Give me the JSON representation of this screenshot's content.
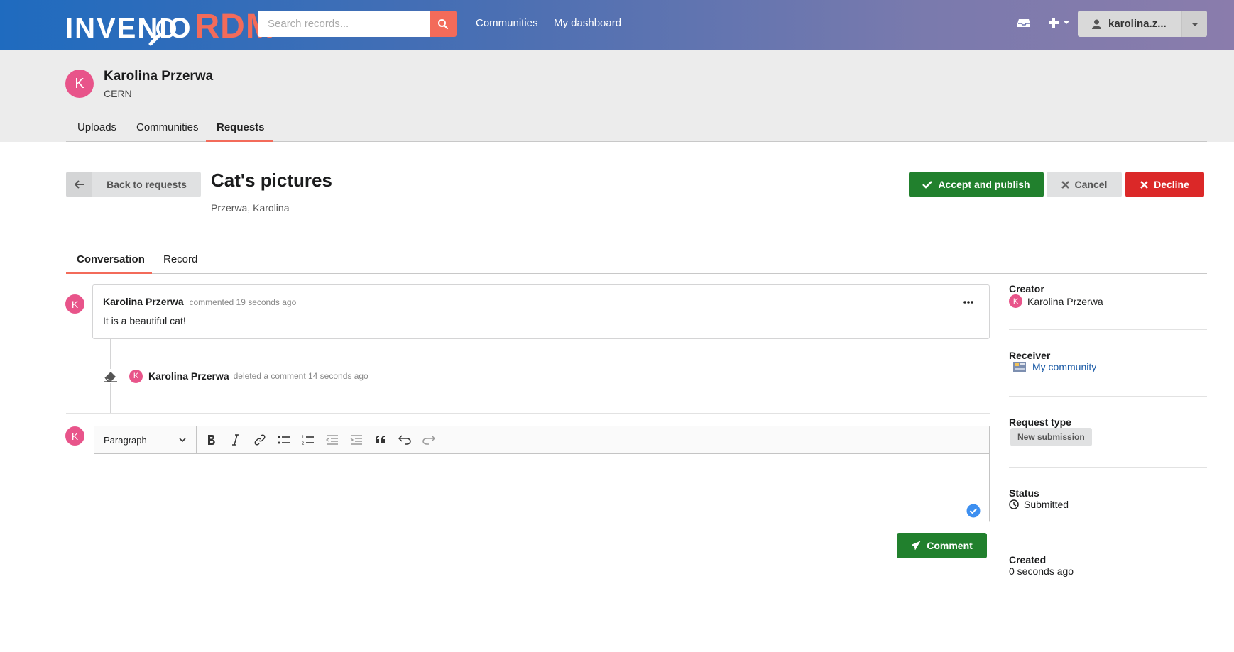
{
  "header": {
    "logo_text": "INVENIO",
    "logo_suffix": "RDM",
    "search_placeholder": "Search records...",
    "nav": [
      "Communities",
      "My dashboard"
    ],
    "user_label": "karolina.z..."
  },
  "profile": {
    "initial": "K",
    "name": "Karolina Przerwa",
    "affiliation": "CERN",
    "tabs": [
      "Uploads",
      "Communities",
      "Requests"
    ],
    "active_tab": "Requests"
  },
  "request": {
    "back_label": "Back to requests",
    "title": "Cat's pictures",
    "creators": "Przerwa, Karolina",
    "actions": {
      "accept": "Accept and publish",
      "cancel": "Cancel",
      "decline": "Decline"
    },
    "tabs": [
      "Conversation",
      "Record"
    ],
    "active_tab": "Conversation"
  },
  "conversation": {
    "comment": {
      "initial": "K",
      "author": "Karolina Przerwa",
      "meta": "commented 19 seconds ago",
      "body": "It is a beautiful cat!"
    },
    "event": {
      "initial": "K",
      "author": "Karolina Przerwa",
      "meta": "deleted a comment 14 seconds ago"
    }
  },
  "editor": {
    "initial": "K",
    "paragraph_select": "Paragraph",
    "toolbar_icons": [
      "bold-icon",
      "italic-icon",
      "link-icon",
      "bullet-list-icon",
      "numbered-list-icon",
      "outdent-icon",
      "indent-icon",
      "blockquote-icon",
      "undo-icon",
      "redo-icon"
    ],
    "comment_button": "Comment"
  },
  "sidebar": {
    "creator_label": "Creator",
    "creator_initial": "K",
    "creator_name": "Karolina Przerwa",
    "receiver_label": "Receiver",
    "receiver_name": "My community",
    "request_type_label": "Request type",
    "request_type": "New submission",
    "status_label": "Status",
    "status": "Submitted",
    "created_label": "Created",
    "created": "0 seconds ago"
  },
  "colors": {
    "accent": "#f36b5a",
    "primary_green": "#21802d",
    "decline_red": "#db2828",
    "avatar_pink": "#e8548a",
    "link_blue": "#1a5aa6"
  }
}
